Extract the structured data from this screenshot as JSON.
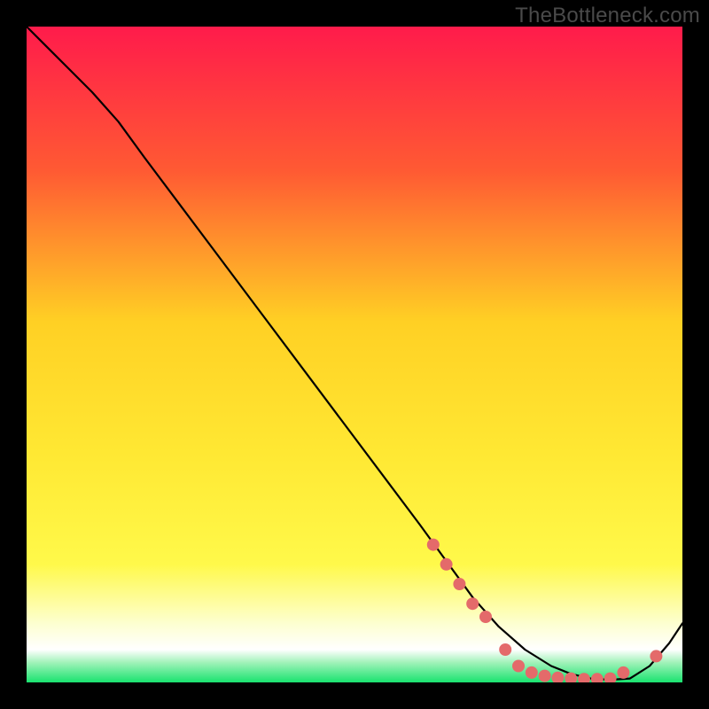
{
  "watermark": "TheBottleneck.com",
  "chart_data": {
    "type": "line",
    "title": "",
    "xlabel": "",
    "ylabel": "",
    "xlim": [
      0,
      100
    ],
    "ylim": [
      0,
      100
    ],
    "grid": false,
    "background_gradient": {
      "top": "#ff1b4b",
      "upper_mid": "#ff7a2a",
      "mid": "#ffd024",
      "lower_mid": "#fff94a",
      "pale": "#fdffd0",
      "white": "#ffffff",
      "green": "#19e36f"
    },
    "series": [
      {
        "name": "bottleneck-curve",
        "color": "#000000",
        "x": [
          0,
          3,
          6,
          10,
          14,
          18,
          24,
          30,
          36,
          42,
          48,
          54,
          60,
          64,
          68,
          72,
          76,
          80,
          83,
          86,
          89,
          92,
          95,
          98,
          100
        ],
        "y": [
          100,
          97,
          94,
          90,
          85.5,
          80,
          72,
          64,
          56,
          48,
          40,
          32,
          24,
          18.5,
          13,
          8.5,
          5,
          2.5,
          1.3,
          0.6,
          0.4,
          0.6,
          2.5,
          6,
          9
        ]
      }
    ],
    "markers": {
      "name": "highlighted-points",
      "color": "#e46a6a",
      "points": [
        {
          "x": 62,
          "y": 21
        },
        {
          "x": 64,
          "y": 18
        },
        {
          "x": 66,
          "y": 15
        },
        {
          "x": 68,
          "y": 12
        },
        {
          "x": 70,
          "y": 10
        },
        {
          "x": 73,
          "y": 5
        },
        {
          "x": 75,
          "y": 2.5
        },
        {
          "x": 77,
          "y": 1.5
        },
        {
          "x": 79,
          "y": 1
        },
        {
          "x": 81,
          "y": 0.7
        },
        {
          "x": 83,
          "y": 0.6
        },
        {
          "x": 85,
          "y": 0.5
        },
        {
          "x": 87,
          "y": 0.5
        },
        {
          "x": 89,
          "y": 0.6
        },
        {
          "x": 91,
          "y": 1.5
        },
        {
          "x": 96,
          "y": 4
        }
      ]
    }
  }
}
